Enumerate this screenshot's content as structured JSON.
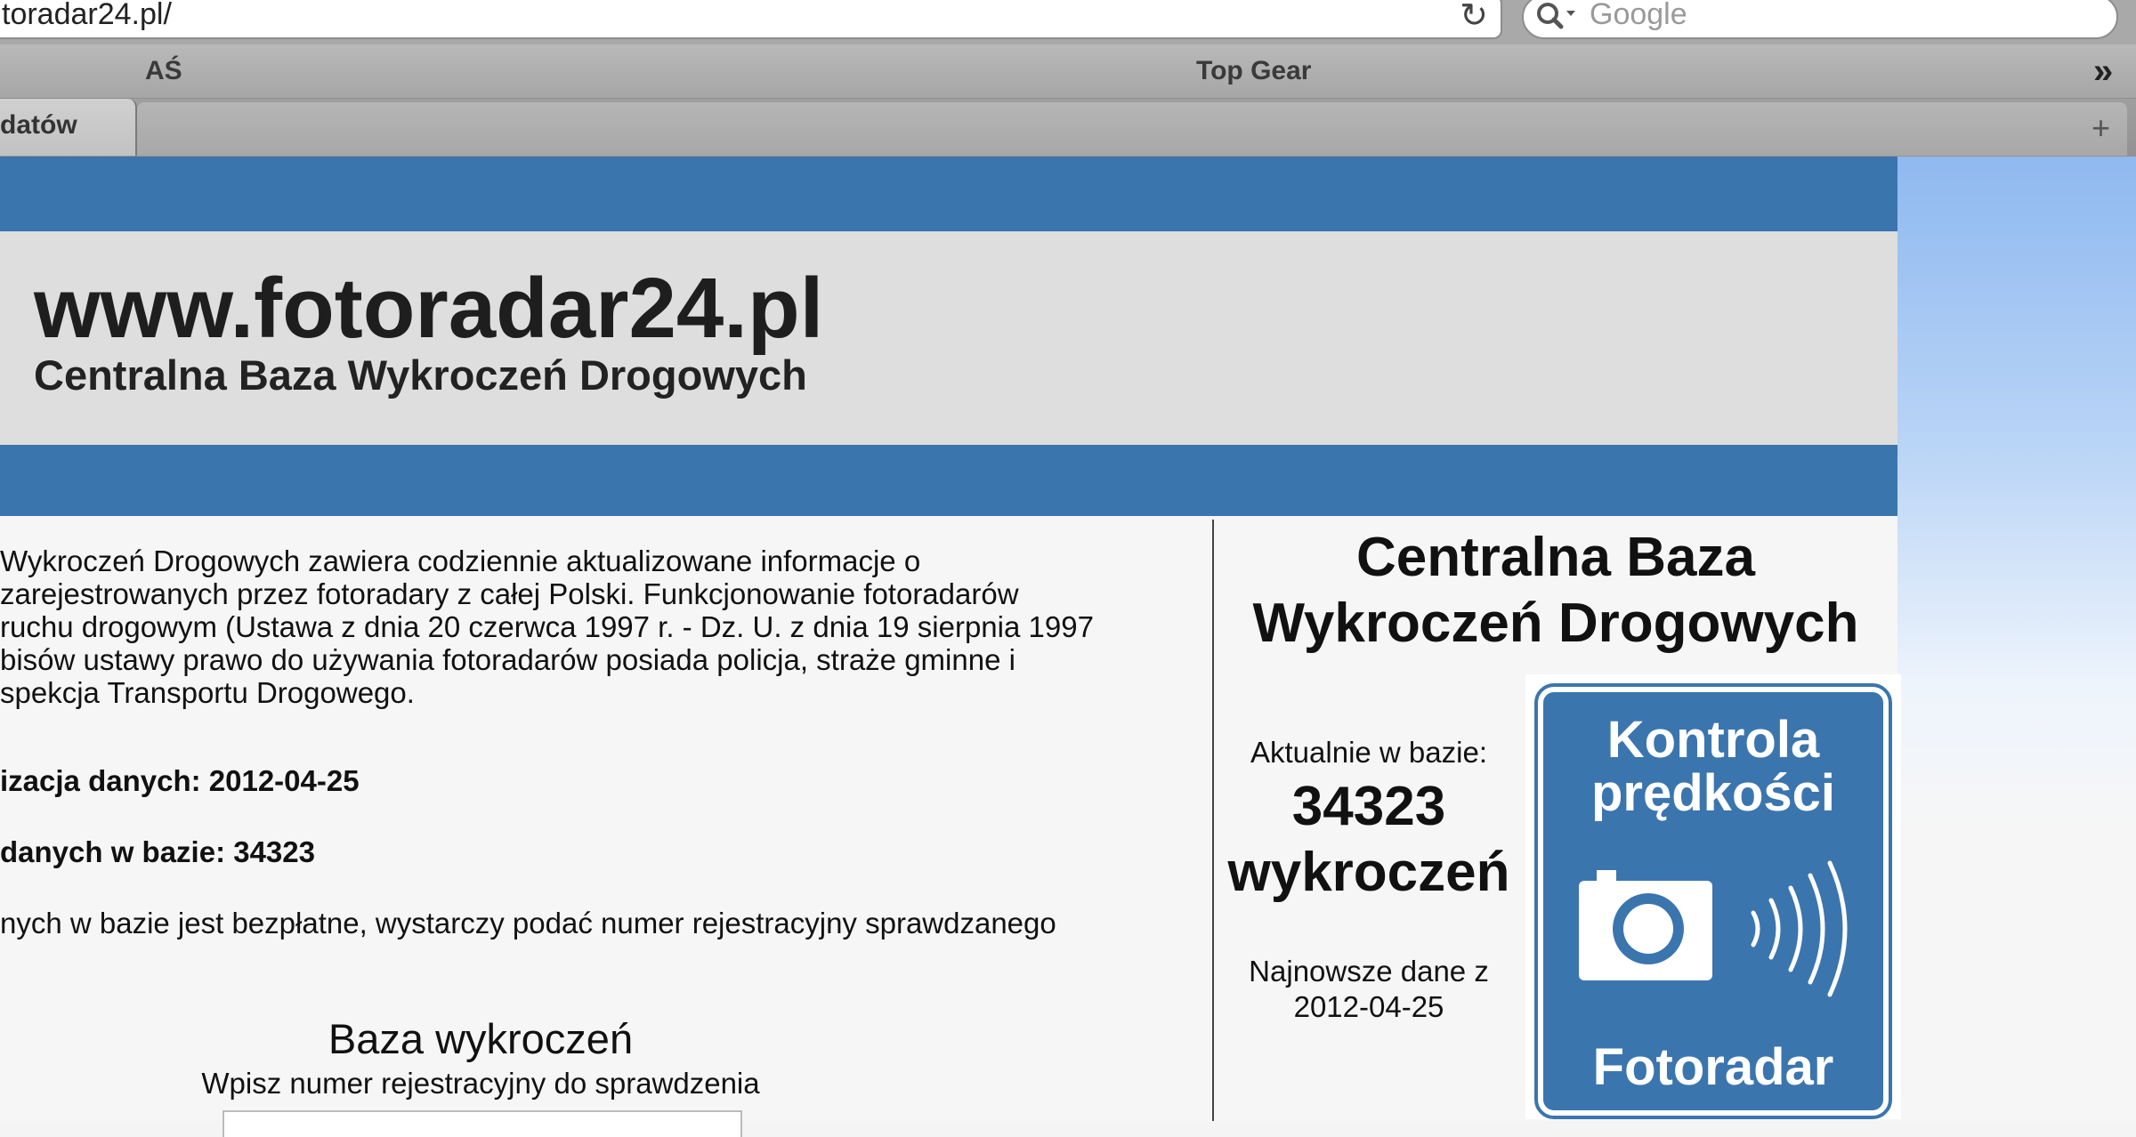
{
  "browser": {
    "address": "toradar24.pl/",
    "search_placeholder": "Google",
    "bookmarks": [
      "AŚ",
      "Top Gear"
    ],
    "overflow_label": "»",
    "active_tab_label": "datów",
    "new_tab_label": "+"
  },
  "banner": {
    "title": "www.fotoradar24.pl",
    "subtitle": "Centralna Baza Wykroczeń Drogowych"
  },
  "main": {
    "paragraph_lines": [
      "Wykroczeń Drogowych zawiera codziennie aktualizowane informacje o",
      "zarejestrowanych przez fotoradary z całej Polski. Funkcjonowanie fotoradarów",
      "ruchu drogowym (Ustawa z dnia 20 czerwca 1997 r. - Dz. U. z dnia 19 sierpnia 1997",
      "bisów ustawy prawo do używania fotoradarów posiada policja, straże gminne i",
      "spekcja Transportu Drogowego."
    ],
    "update_line": "izacja danych: 2012-04-25",
    "count_line": "danych w bazie: 34323",
    "free_line": "nych w bazie jest bezpłatne, wystarczy podać numer rejestracyjny sprawdzanego",
    "search_heading": "Baza wykroczeń",
    "search_hint": "Wpisz numer rejestracyjny do sprawdzenia",
    "plate_input_value": ""
  },
  "sidebar": {
    "title_line1": "Centralna Baza",
    "title_line2": "Wykroczeń Drogowych",
    "counter_label": "Aktualnie w bazie:",
    "counter_number": "34323",
    "counter_unit": "wykroczeń",
    "latest_label": "Najnowsze dane z",
    "latest_date": "2012-04-25"
  },
  "sign": {
    "line1": "Kontrola",
    "line2": "prędkości",
    "bottom": "Fotoradar"
  },
  "colors": {
    "brand_blue": "#3b75ae",
    "banner_grey": "#dedede"
  }
}
